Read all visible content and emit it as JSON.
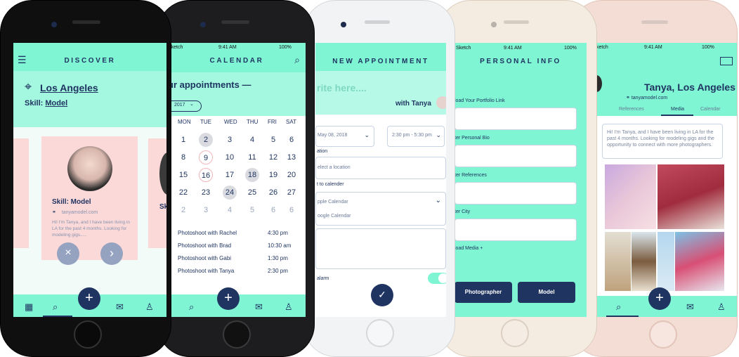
{
  "phone1": {
    "title": "DISCOVER",
    "location": "Los Angeles",
    "skill_prefix": "Skill: ",
    "skill_value": "Model",
    "card": {
      "skill": "Skill: Model",
      "link": "tanyamodel.com",
      "bio": "Hi! I'm Tanya, and I have been living in LA for the past 4 months. Looking for modeling gigs....."
    },
    "side_card_text": "Sk",
    "reject_icon": "×",
    "accept_icon": "›"
  },
  "phone2": {
    "status_left": "Sketch",
    "status_time": "9:41 AM",
    "status_right": "100%",
    "title": "CALENDAR",
    "heading": "ur appointments —",
    "year": "2017",
    "weekdays": [
      "MON",
      "TUE",
      "WED",
      "THU",
      "FRI",
      "SAT"
    ],
    "weeks": [
      [
        "1",
        "2",
        "3",
        "4",
        "5",
        "6"
      ],
      [
        "8",
        "9",
        "10",
        "11",
        "12",
        "13"
      ],
      [
        "15",
        "16",
        "17",
        "18",
        "19",
        "20"
      ],
      [
        "22",
        "23",
        "24",
        "25",
        "26",
        "27"
      ],
      [
        "2",
        "3",
        "4",
        "5",
        "6",
        "6"
      ]
    ],
    "appointments": [
      {
        "name": "Photoshoot with Rachel",
        "time": "4:30 pm"
      },
      {
        "name": "Photoshoot with Brad",
        "time": "10:30 am"
      },
      {
        "name": "Photoshoot with Gabi",
        "time": "1:30 pm"
      },
      {
        "name": "Photoshoot with Tanya",
        "time": "2:30 pm"
      }
    ]
  },
  "phone3": {
    "title": "NEW APPOINTMENT",
    "prompt": "rite here....",
    "with": "with Tanya",
    "date": "May 08, 2018",
    "time": "2:30 pm - 5:30 pm",
    "location_label": "ation",
    "location_placeholder": "elect a location",
    "calendar_label": "t to calender",
    "cal_option1": "pple Calendar",
    "cal_option2": "oogle Calendar",
    "alarm_label": "alarm",
    "confirm_icon": "✓"
  },
  "phone4": {
    "status_left": "Sketch",
    "status_time": "9:41 AM",
    "status_right": "100%",
    "title": "PERSONAL INFO",
    "label1": "load Your Portfolio Link",
    "label2": "ter Personal Bio",
    "label3": "ter References",
    "label4": "ter City",
    "media": "load Media +",
    "btn1": "Photographer",
    "btn2": "Model"
  },
  "phone5": {
    "status_left": "ketch",
    "status_time": "9:41 AM",
    "status_right": "100%",
    "name": "Tanya, Los Angeles",
    "link": "tanyamodel.com",
    "tabs": [
      "References",
      "Media",
      "Calendar"
    ],
    "bio": "Hi! I'm Tanya, and I have been living in LA for the past 4 months. Looking for modeling gigs and the opportunity to connect with more photographers."
  },
  "colors": {
    "mint": "#7ff5d3",
    "navy": "#1f3461",
    "pink": "#fcd9d9"
  }
}
